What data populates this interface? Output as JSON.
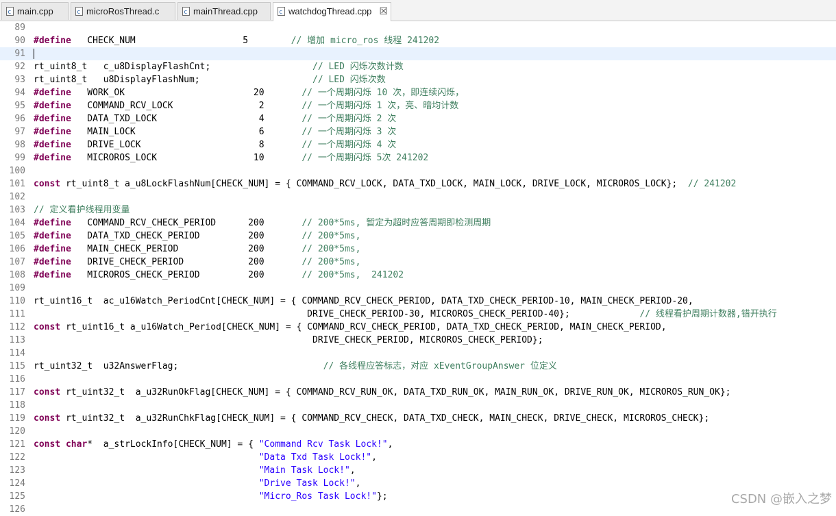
{
  "tabs": [
    {
      "label": "main.cpp",
      "active": false
    },
    {
      "label": "microRosThread.c",
      "active": false
    },
    {
      "label": "mainThread.cpp",
      "active": false
    },
    {
      "label": "watchdogThread.cpp",
      "active": true,
      "close": "☒"
    }
  ],
  "editor": {
    "lines": [
      {
        "n": "89",
        "segs": []
      },
      {
        "n": "90",
        "segs": [
          [
            "kw",
            "#define"
          ],
          [
            "",
            "   CHECK_NUM                    5        "
          ],
          [
            "cm",
            "// 增加 micro_ros 线程 241202"
          ]
        ]
      },
      {
        "n": "91",
        "segs": [],
        "current": true
      },
      {
        "n": "92",
        "segs": [
          [
            "",
            "rt_uint8_t   c_u8DisplayFlashCnt;                   "
          ],
          [
            "cm",
            "// LED 闪烁次数计数"
          ]
        ]
      },
      {
        "n": "93",
        "segs": [
          [
            "",
            "rt_uint8_t   u8DisplayFlashNum;                     "
          ],
          [
            "cm",
            "// LED 闪烁次数"
          ]
        ]
      },
      {
        "n": "94",
        "segs": [
          [
            "kw",
            "#define"
          ],
          [
            "",
            "   WORK_OK                        20       "
          ],
          [
            "cm",
            "// 一个周期闪烁 10 次，即连续闪烁，"
          ]
        ]
      },
      {
        "n": "95",
        "segs": [
          [
            "kw",
            "#define"
          ],
          [
            "",
            "   COMMAND_RCV_LOCK                2       "
          ],
          [
            "cm",
            "// 一个周期闪烁 1 次，亮、暗均计数"
          ]
        ]
      },
      {
        "n": "96",
        "segs": [
          [
            "kw",
            "#define"
          ],
          [
            "",
            "   DATA_TXD_LOCK                   4       "
          ],
          [
            "cm",
            "// 一个周期闪烁 2 次"
          ]
        ]
      },
      {
        "n": "97",
        "segs": [
          [
            "kw",
            "#define"
          ],
          [
            "",
            "   MAIN_LOCK                       6       "
          ],
          [
            "cm",
            "// 一个周期闪烁 3 次"
          ]
        ]
      },
      {
        "n": "98",
        "segs": [
          [
            "kw",
            "#define"
          ],
          [
            "",
            "   DRIVE_LOCK                      8       "
          ],
          [
            "cm",
            "// 一个周期闪烁 4 次"
          ]
        ]
      },
      {
        "n": "99",
        "segs": [
          [
            "kw",
            "#define"
          ],
          [
            "",
            "   MICROROS_LOCK                  10       "
          ],
          [
            "cm",
            "// 一个周期闪烁 5次 241202"
          ]
        ]
      },
      {
        "n": "100",
        "segs": []
      },
      {
        "n": "101",
        "segs": [
          [
            "kw",
            "const"
          ],
          [
            "",
            " rt_uint8_t a_u8LockFlashNum[CHECK_NUM] = { COMMAND_RCV_LOCK, DATA_TXD_LOCK, MAIN_LOCK, DRIVE_LOCK, MICROROS_LOCK};  "
          ],
          [
            "cm",
            "// 241202"
          ]
        ]
      },
      {
        "n": "102",
        "segs": []
      },
      {
        "n": "103",
        "segs": [
          [
            "cm",
            "// 定义看护线程用变量"
          ]
        ]
      },
      {
        "n": "104",
        "segs": [
          [
            "kw",
            "#define"
          ],
          [
            "",
            "   COMMAND_RCV_CHECK_PERIOD      200       "
          ],
          [
            "cm",
            "// 200*5ms, 暂定为超时应答周期即检测周期"
          ]
        ]
      },
      {
        "n": "105",
        "segs": [
          [
            "kw",
            "#define"
          ],
          [
            "",
            "   DATA_TXD_CHECK_PERIOD         200       "
          ],
          [
            "cm",
            "// 200*5ms,"
          ]
        ]
      },
      {
        "n": "106",
        "segs": [
          [
            "kw",
            "#define"
          ],
          [
            "",
            "   MAIN_CHECK_PERIOD             200       "
          ],
          [
            "cm",
            "// 200*5ms,"
          ]
        ]
      },
      {
        "n": "107",
        "segs": [
          [
            "kw",
            "#define"
          ],
          [
            "",
            "   DRIVE_CHECK_PERIOD            200       "
          ],
          [
            "cm",
            "// 200*5ms,"
          ]
        ]
      },
      {
        "n": "108",
        "segs": [
          [
            "kw",
            "#define"
          ],
          [
            "",
            "   MICROROS_CHECK_PERIOD         200       "
          ],
          [
            "cm",
            "// 200*5ms,  241202"
          ]
        ]
      },
      {
        "n": "109",
        "segs": []
      },
      {
        "n": "110",
        "segs": [
          [
            "",
            "rt_uint16_t  ac_u16Watch_PeriodCnt[CHECK_NUM] = { COMMAND_RCV_CHECK_PERIOD, DATA_TXD_CHECK_PERIOD-10, MAIN_CHECK_PERIOD-20,"
          ]
        ]
      },
      {
        "n": "111",
        "segs": [
          [
            "",
            "                                                   DRIVE_CHECK_PERIOD-30, MICROROS_CHECK_PERIOD-40};             "
          ],
          [
            "cm",
            "// 线程看护周期计数器,错开执行"
          ]
        ]
      },
      {
        "n": "112",
        "segs": [
          [
            "kw",
            "const"
          ],
          [
            "",
            " rt_uint16_t a_u16Watch_Period[CHECK_NUM] = { COMMAND_RCV_CHECK_PERIOD, DATA_TXD_CHECK_PERIOD, MAIN_CHECK_PERIOD,"
          ]
        ]
      },
      {
        "n": "113",
        "segs": [
          [
            "",
            "                                                    DRIVE_CHECK_PERIOD, MICROROS_CHECK_PERIOD};"
          ]
        ]
      },
      {
        "n": "114",
        "segs": []
      },
      {
        "n": "115",
        "segs": [
          [
            "",
            "rt_uint32_t  u32AnswerFlag;                           "
          ],
          [
            "cm",
            "// 各线程应答标志，对应 xEventGroupAnswer 位定义"
          ]
        ]
      },
      {
        "n": "116",
        "segs": []
      },
      {
        "n": "117",
        "segs": [
          [
            "kw",
            "const"
          ],
          [
            "",
            " rt_uint32_t  a_u32RunOkFlag[CHECK_NUM] = { COMMAND_RCV_RUN_OK, DATA_TXD_RUN_OK, MAIN_RUN_OK, DRIVE_RUN_OK, MICROROS_RUN_OK};"
          ]
        ]
      },
      {
        "n": "118",
        "segs": []
      },
      {
        "n": "119",
        "segs": [
          [
            "kw",
            "const"
          ],
          [
            "",
            " rt_uint32_t  a_u32RunChkFlag[CHECK_NUM] = { COMMAND_RCV_CHECK, DATA_TXD_CHECK, MAIN_CHECK, DRIVE_CHECK, MICROROS_CHECK};"
          ]
        ]
      },
      {
        "n": "120",
        "segs": []
      },
      {
        "n": "121",
        "segs": [
          [
            "kw",
            "const"
          ],
          [
            "",
            " "
          ],
          [
            "kw",
            "char"
          ],
          [
            "",
            "*  a_strLockInfo[CHECK_NUM] = { "
          ],
          [
            "st",
            "\"Command Rcv Task Lock!\""
          ],
          [
            "",
            ","
          ]
        ]
      },
      {
        "n": "122",
        "segs": [
          [
            "",
            "                                          "
          ],
          [
            "st",
            "\"Data Txd Task Lock!\""
          ],
          [
            "",
            ","
          ]
        ]
      },
      {
        "n": "123",
        "segs": [
          [
            "",
            "                                          "
          ],
          [
            "st",
            "\"Main Task Lock!\""
          ],
          [
            "",
            ","
          ]
        ]
      },
      {
        "n": "124",
        "segs": [
          [
            "",
            "                                          "
          ],
          [
            "st",
            "\"Drive Task Lock!\""
          ],
          [
            "",
            ","
          ]
        ]
      },
      {
        "n": "125",
        "segs": [
          [
            "",
            "                                          "
          ],
          [
            "st",
            "\"Micro_Ros Task Lock!\""
          ],
          [
            "",
            "};"
          ]
        ]
      },
      {
        "n": "126",
        "segs": []
      }
    ]
  },
  "watermark": "CSDN @嵌入之梦"
}
